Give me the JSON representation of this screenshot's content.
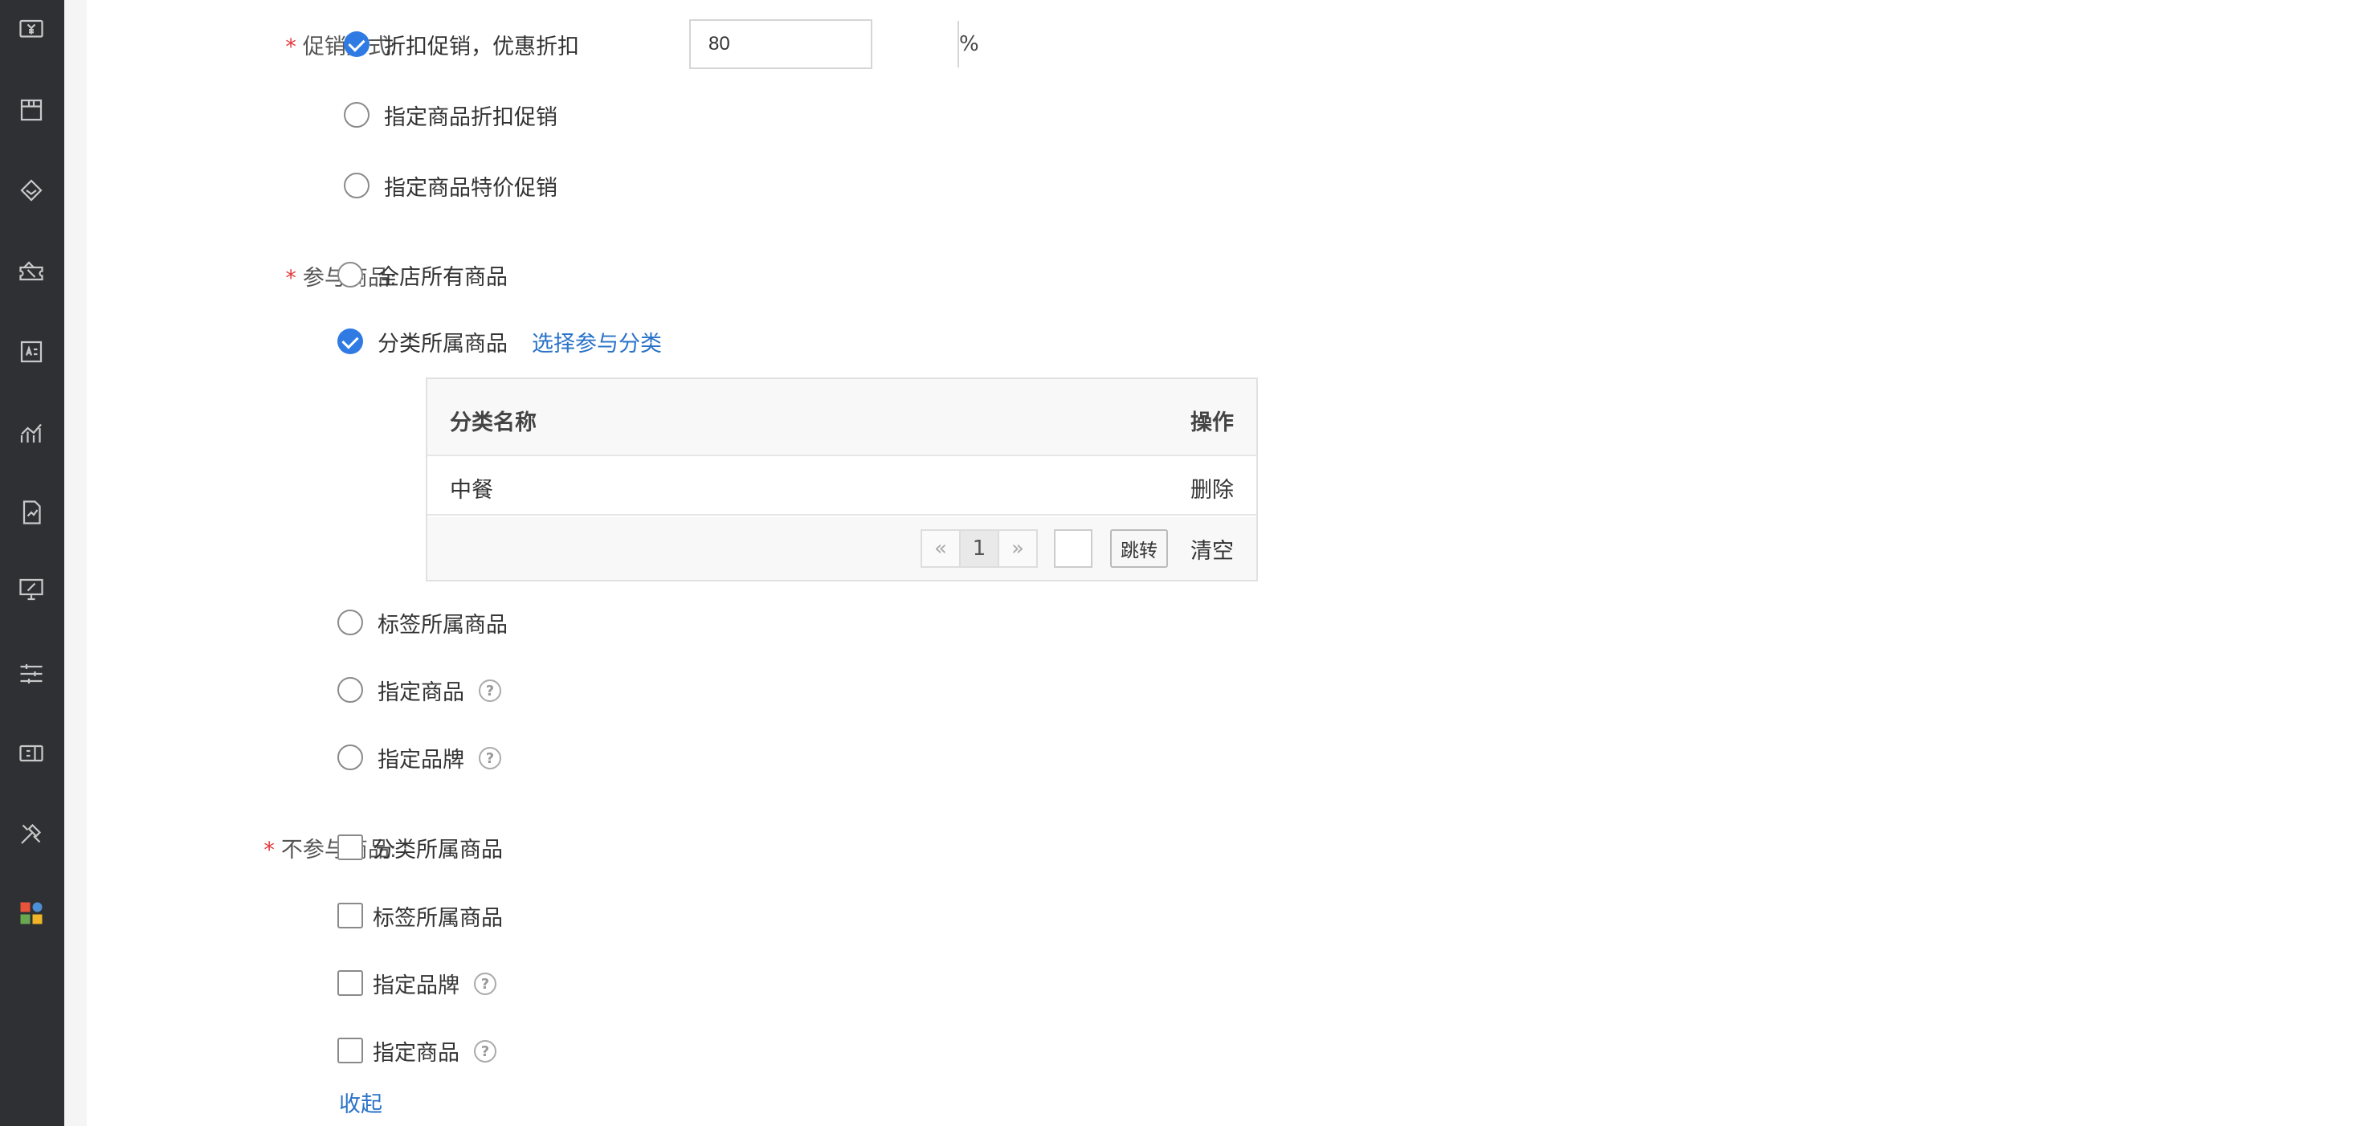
{
  "sidebar": {
    "icons": [
      "yen-screen-icon",
      "package-icon",
      "diamond-tag-icon",
      "coupon-icon",
      "id-card-icon",
      "trend-chart-icon",
      "report-icon",
      "monitor-percent-icon",
      "sliders-icon",
      "ticket-icon",
      "tools-icon",
      "apps-grid-icon"
    ]
  },
  "promo_method": {
    "label": "促销方式:",
    "options": [
      {
        "text": "折扣促销，优惠折扣",
        "checked": true
      },
      {
        "text": "指定商品折扣促销",
        "checked": false
      },
      {
        "text": "指定商品特价促销",
        "checked": false
      }
    ],
    "discount_value": "80",
    "discount_unit": "%"
  },
  "participating": {
    "label": "参与商品:",
    "options": [
      {
        "text": "全店所有商品",
        "checked": false
      },
      {
        "text": "分类所属商品",
        "checked": true
      },
      {
        "text": "标签所属商品",
        "checked": false
      },
      {
        "text": "指定商品",
        "checked": false
      },
      {
        "text": "指定品牌",
        "checked": false
      }
    ],
    "select_category_link": "选择参与分类",
    "table": {
      "col_name": "分类名称",
      "col_action": "操作",
      "rows": [
        {
          "name": "中餐",
          "action": "删除"
        }
      ],
      "pager": {
        "prev": "«",
        "current": "1",
        "next": "»",
        "jump_label": "跳转",
        "clear_label": "清空"
      }
    }
  },
  "excluded": {
    "label": "不参与商品:",
    "options": [
      {
        "text": "分类所属商品",
        "checked": false
      },
      {
        "text": "标签所属商品",
        "checked": false
      },
      {
        "text": "指定品牌",
        "checked": false
      },
      {
        "text": "指定商品",
        "checked": false
      }
    ],
    "collapse_label": "收起"
  },
  "help_glyph": "?",
  "required_mark": "*"
}
